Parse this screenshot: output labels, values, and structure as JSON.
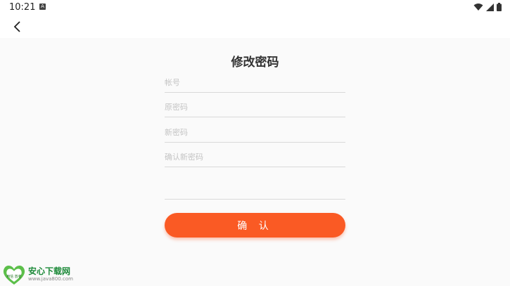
{
  "status": {
    "time": "10:21",
    "notif_letter": "A"
  },
  "header": {
    "title": "修改密码"
  },
  "form": {
    "account_placeholder": "帐号",
    "old_password_placeholder": "原密码",
    "new_password_placeholder": "新密码",
    "confirm_password_placeholder": "确认新密码",
    "submit_label": "确 认"
  },
  "watermark": {
    "name": "安心下载网",
    "url": "www.java800.com",
    "logo_text": "用信 放者"
  },
  "colors": {
    "accent": "#fa5a24",
    "background": "#fafafa",
    "divider": "#d9d9d9"
  },
  "icons": [
    "back-arrow-icon",
    "wifi-icon",
    "signal-icon",
    "battery-icon"
  ]
}
